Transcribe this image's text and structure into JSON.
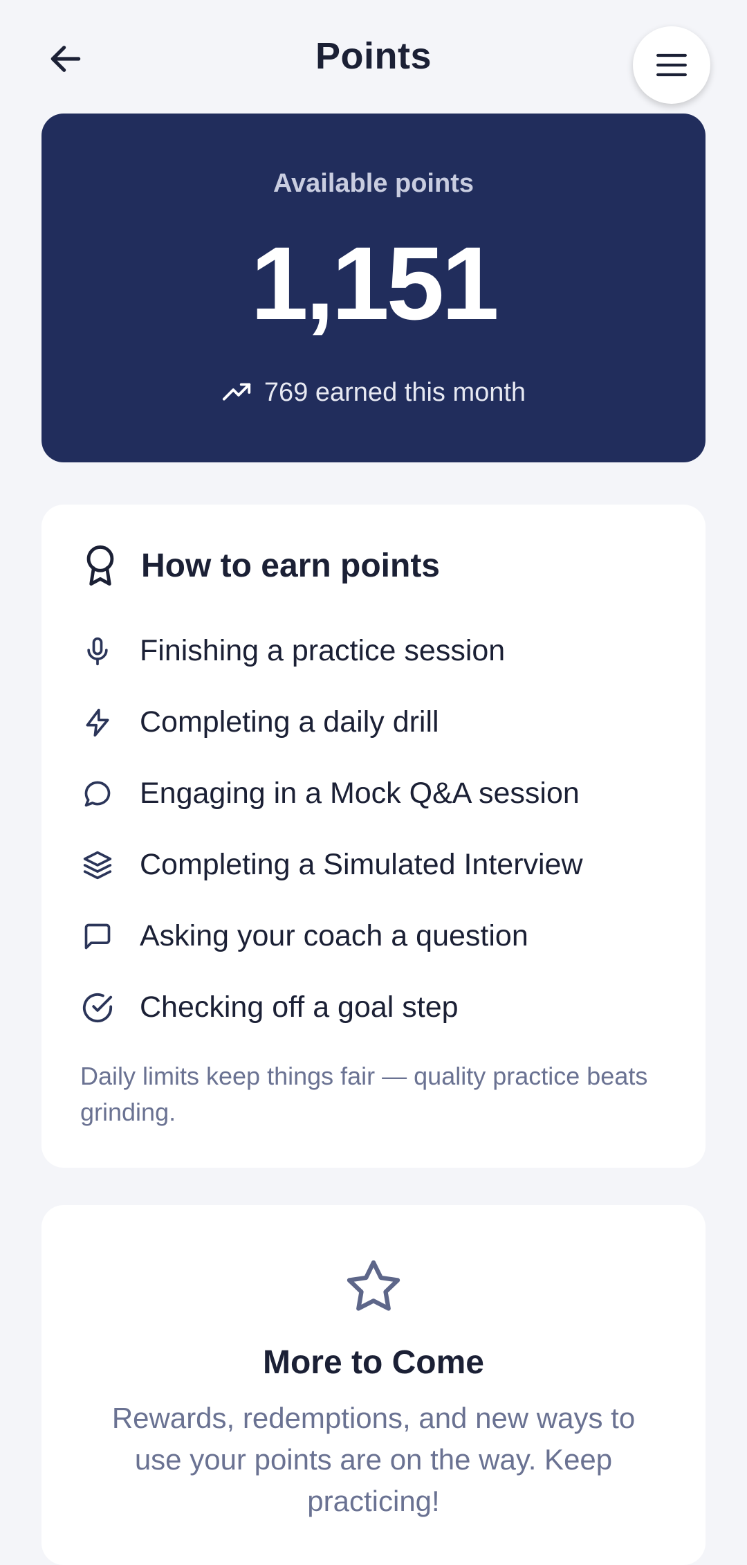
{
  "header": {
    "title": "Points",
    "back_icon": "arrow-left-icon",
    "menu_icon": "hamburger-menu-icon"
  },
  "points_card": {
    "label": "Available points",
    "value": "1,151",
    "earned_icon": "trending-up-icon",
    "earned_text": "769 earned this month",
    "background_color": "#212d5c"
  },
  "earn_section": {
    "icon": "award-ribbon-icon",
    "title": "How to earn points",
    "items": [
      {
        "icon": "microphone-icon",
        "label": "Finishing a practice session"
      },
      {
        "icon": "lightning-icon",
        "label": "Completing a daily drill"
      },
      {
        "icon": "chat-bubble-icon",
        "label": "Engaging in a Mock Q&A session"
      },
      {
        "icon": "layers-icon",
        "label": "Completing a Simulated Interview"
      },
      {
        "icon": "message-square-icon",
        "label": "Asking your coach a question"
      },
      {
        "icon": "check-circle-icon",
        "label": "Checking off a goal step"
      }
    ],
    "note": "Daily limits keep things fair — quality practice beats grinding."
  },
  "more_section": {
    "icon": "star-icon",
    "title": "More to Come",
    "text": "Rewards, redemptions, and new ways to use your points are on the way. Keep practicing!"
  }
}
